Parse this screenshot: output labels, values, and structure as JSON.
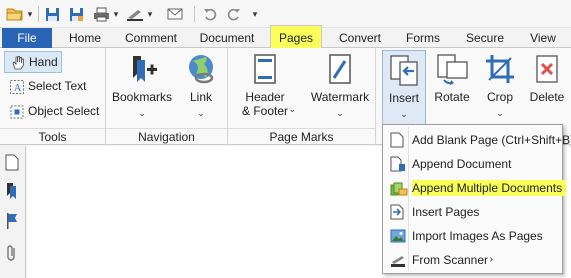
{
  "quick_access": {
    "icons": [
      "folder-open-icon",
      "save-icon",
      "save-as-icon",
      "print-icon",
      "brush-icon",
      "email-icon",
      "undo-icon",
      "redo-icon"
    ]
  },
  "tabs": [
    {
      "label": "File"
    },
    {
      "label": "Home"
    },
    {
      "label": "Comment"
    },
    {
      "label": "Document"
    },
    {
      "label": "Pages"
    },
    {
      "label": "Convert"
    },
    {
      "label": "Forms"
    },
    {
      "label": "Secure"
    },
    {
      "label": "View"
    }
  ],
  "ribbon": {
    "tools": {
      "label": "Tools",
      "items": [
        {
          "label": "Hand"
        },
        {
          "label": "Select Text"
        },
        {
          "label": "Object Select"
        }
      ]
    },
    "navigation": {
      "label": "Navigation",
      "bookmarks": "Bookmarks",
      "link": "Link"
    },
    "page_marks": {
      "label": "Page Marks",
      "header_footer_line1": "Header",
      "header_footer_line2": "& Footer",
      "watermark": "Watermark"
    },
    "pages": {
      "insert": "Insert",
      "rotate": "Rotate",
      "crop": "Crop",
      "delete": "Delete"
    }
  },
  "insert_menu": {
    "items": [
      {
        "label": "Add Blank Page  (Ctrl+Shift+B)"
      },
      {
        "label": "Append Document"
      },
      {
        "label": "Append Multiple Documents"
      },
      {
        "label": "Insert Pages"
      },
      {
        "label": "Import Images As Pages"
      },
      {
        "label": "From Scanner"
      }
    ]
  },
  "colors": {
    "file_tab": "#2a64b5",
    "highlight": "#fbff5a",
    "accent_blue": "#2f6db8"
  }
}
